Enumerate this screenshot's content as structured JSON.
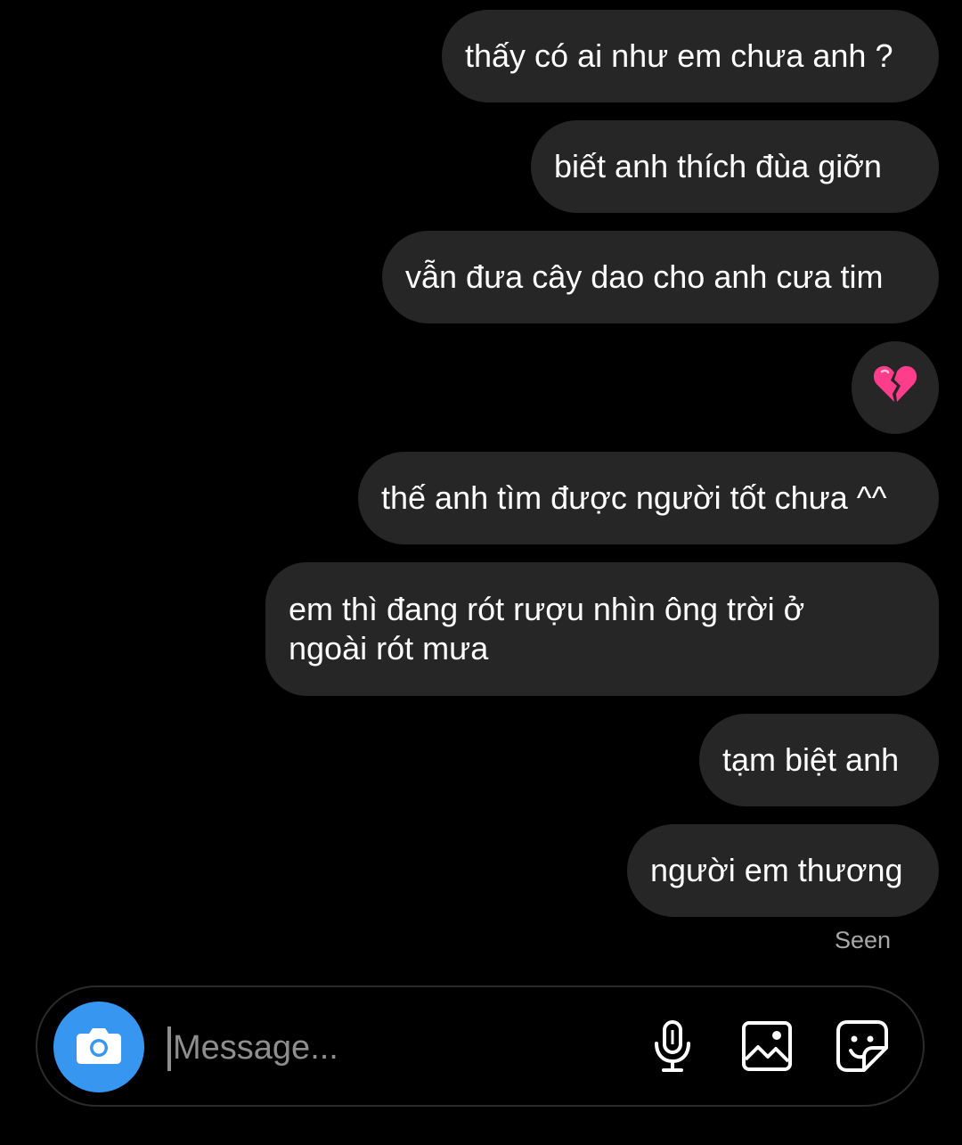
{
  "messages": [
    {
      "text": "thấy có ai như em chưa anh ?"
    },
    {
      "text": "biết anh thích đùa giỡn"
    },
    {
      "text": "vẫn đưa cây dao cho anh cưa tim"
    },
    {
      "text": "💔",
      "icon": "broken-heart-emoji"
    },
    {
      "text": "thế anh tìm được người tốt chưa ^^"
    },
    {
      "text": "em thì đang rót rượu nhìn ông trời ở ngoài rót mưa"
    },
    {
      "text": "tạm biệt anh"
    },
    {
      "text": "người em thương"
    }
  ],
  "status": {
    "seen": "Seen"
  },
  "composer": {
    "placeholder": "Message...",
    "value": "",
    "icons": [
      "camera-icon",
      "microphone-icon",
      "gallery-icon",
      "sticker-icon"
    ]
  },
  "colors": {
    "background": "#000000",
    "bubble": "#262626",
    "text": "#ffffff",
    "muted": "#a8a8a8",
    "accent": "#3797f0",
    "heart": "#ff3d8b"
  }
}
